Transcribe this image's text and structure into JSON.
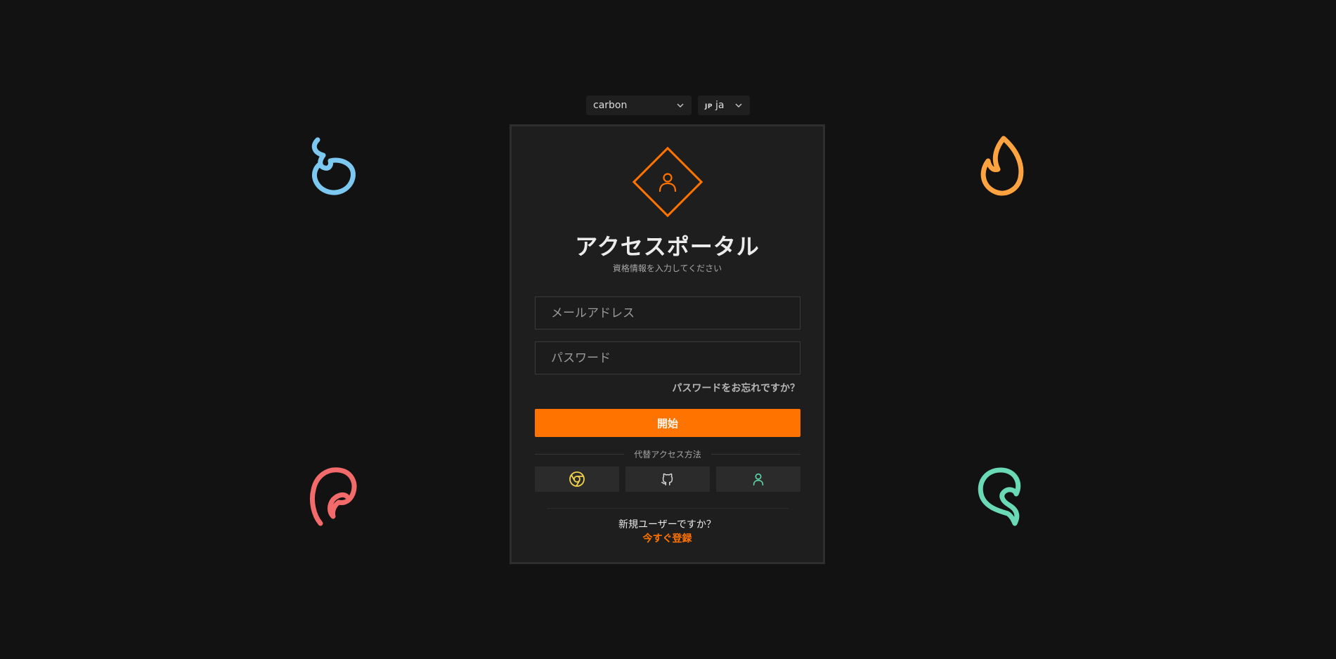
{
  "selectors": {
    "theme": "carbon",
    "lang_code": "JP",
    "lang": "ja"
  },
  "card": {
    "title": "アクセスポータル",
    "subtitle": "資格情報を入力してください",
    "email_placeholder": "メールアドレス",
    "password_placeholder": "パスワード",
    "forgot_link": "パスワードをお忘れですか？",
    "submit_label": "開始",
    "alt_divider": "代替アクセス方法",
    "new_user_text": "新規ユーザーですか？",
    "register_link": "今すぐ登録"
  },
  "alt_providers": [
    {
      "icon": "chrome-icon",
      "color": "#f2d24a"
    },
    {
      "icon": "github-icon",
      "color": "#d8d8d8"
    },
    {
      "icon": "user-icon",
      "color": "#5fd4a8"
    }
  ],
  "colors": {
    "accent": "#ff7300",
    "background": "#121212",
    "card": "#1e1e1e",
    "deco_blue": "#7cc8f0",
    "deco_orange": "#ffa340",
    "deco_red": "#f26a6a",
    "deco_green": "#6ad9b5"
  }
}
